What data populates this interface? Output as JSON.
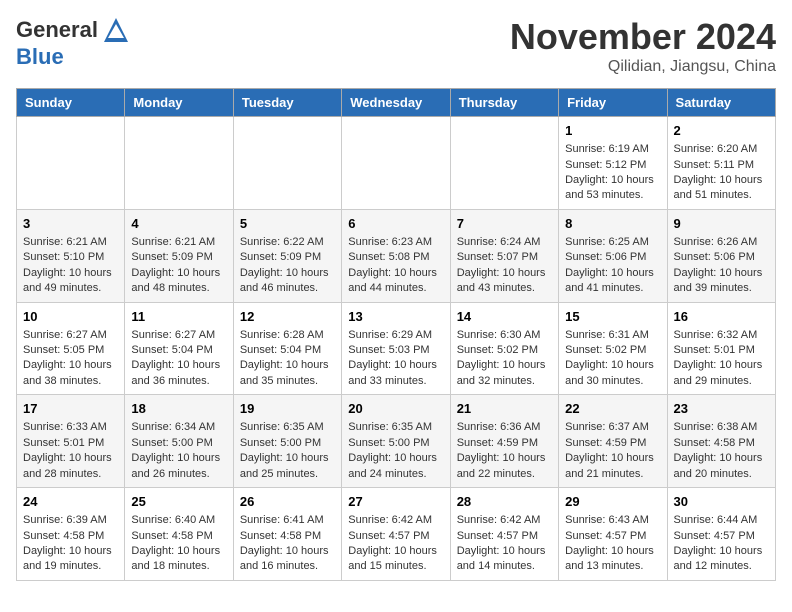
{
  "header": {
    "logo_general": "General",
    "logo_blue": "Blue",
    "month_title": "November 2024",
    "location": "Qilidian, Jiangsu, China"
  },
  "days_of_week": [
    "Sunday",
    "Monday",
    "Tuesday",
    "Wednesday",
    "Thursday",
    "Friday",
    "Saturday"
  ],
  "weeks": [
    [
      {
        "day": "",
        "info": ""
      },
      {
        "day": "",
        "info": ""
      },
      {
        "day": "",
        "info": ""
      },
      {
        "day": "",
        "info": ""
      },
      {
        "day": "",
        "info": ""
      },
      {
        "day": "1",
        "info": "Sunrise: 6:19 AM\nSunset: 5:12 PM\nDaylight: 10 hours\nand 53 minutes."
      },
      {
        "day": "2",
        "info": "Sunrise: 6:20 AM\nSunset: 5:11 PM\nDaylight: 10 hours\nand 51 minutes."
      }
    ],
    [
      {
        "day": "3",
        "info": "Sunrise: 6:21 AM\nSunset: 5:10 PM\nDaylight: 10 hours\nand 49 minutes."
      },
      {
        "day": "4",
        "info": "Sunrise: 6:21 AM\nSunset: 5:09 PM\nDaylight: 10 hours\nand 48 minutes."
      },
      {
        "day": "5",
        "info": "Sunrise: 6:22 AM\nSunset: 5:09 PM\nDaylight: 10 hours\nand 46 minutes."
      },
      {
        "day": "6",
        "info": "Sunrise: 6:23 AM\nSunset: 5:08 PM\nDaylight: 10 hours\nand 44 minutes."
      },
      {
        "day": "7",
        "info": "Sunrise: 6:24 AM\nSunset: 5:07 PM\nDaylight: 10 hours\nand 43 minutes."
      },
      {
        "day": "8",
        "info": "Sunrise: 6:25 AM\nSunset: 5:06 PM\nDaylight: 10 hours\nand 41 minutes."
      },
      {
        "day": "9",
        "info": "Sunrise: 6:26 AM\nSunset: 5:06 PM\nDaylight: 10 hours\nand 39 minutes."
      }
    ],
    [
      {
        "day": "10",
        "info": "Sunrise: 6:27 AM\nSunset: 5:05 PM\nDaylight: 10 hours\nand 38 minutes."
      },
      {
        "day": "11",
        "info": "Sunrise: 6:27 AM\nSunset: 5:04 PM\nDaylight: 10 hours\nand 36 minutes."
      },
      {
        "day": "12",
        "info": "Sunrise: 6:28 AM\nSunset: 5:04 PM\nDaylight: 10 hours\nand 35 minutes."
      },
      {
        "day": "13",
        "info": "Sunrise: 6:29 AM\nSunset: 5:03 PM\nDaylight: 10 hours\nand 33 minutes."
      },
      {
        "day": "14",
        "info": "Sunrise: 6:30 AM\nSunset: 5:02 PM\nDaylight: 10 hours\nand 32 minutes."
      },
      {
        "day": "15",
        "info": "Sunrise: 6:31 AM\nSunset: 5:02 PM\nDaylight: 10 hours\nand 30 minutes."
      },
      {
        "day": "16",
        "info": "Sunrise: 6:32 AM\nSunset: 5:01 PM\nDaylight: 10 hours\nand 29 minutes."
      }
    ],
    [
      {
        "day": "17",
        "info": "Sunrise: 6:33 AM\nSunset: 5:01 PM\nDaylight: 10 hours\nand 28 minutes."
      },
      {
        "day": "18",
        "info": "Sunrise: 6:34 AM\nSunset: 5:00 PM\nDaylight: 10 hours\nand 26 minutes."
      },
      {
        "day": "19",
        "info": "Sunrise: 6:35 AM\nSunset: 5:00 PM\nDaylight: 10 hours\nand 25 minutes."
      },
      {
        "day": "20",
        "info": "Sunrise: 6:35 AM\nSunset: 5:00 PM\nDaylight: 10 hours\nand 24 minutes."
      },
      {
        "day": "21",
        "info": "Sunrise: 6:36 AM\nSunset: 4:59 PM\nDaylight: 10 hours\nand 22 minutes."
      },
      {
        "day": "22",
        "info": "Sunrise: 6:37 AM\nSunset: 4:59 PM\nDaylight: 10 hours\nand 21 minutes."
      },
      {
        "day": "23",
        "info": "Sunrise: 6:38 AM\nSunset: 4:58 PM\nDaylight: 10 hours\nand 20 minutes."
      }
    ],
    [
      {
        "day": "24",
        "info": "Sunrise: 6:39 AM\nSunset: 4:58 PM\nDaylight: 10 hours\nand 19 minutes."
      },
      {
        "day": "25",
        "info": "Sunrise: 6:40 AM\nSunset: 4:58 PM\nDaylight: 10 hours\nand 18 minutes."
      },
      {
        "day": "26",
        "info": "Sunrise: 6:41 AM\nSunset: 4:58 PM\nDaylight: 10 hours\nand 16 minutes."
      },
      {
        "day": "27",
        "info": "Sunrise: 6:42 AM\nSunset: 4:57 PM\nDaylight: 10 hours\nand 15 minutes."
      },
      {
        "day": "28",
        "info": "Sunrise: 6:42 AM\nSunset: 4:57 PM\nDaylight: 10 hours\nand 14 minutes."
      },
      {
        "day": "29",
        "info": "Sunrise: 6:43 AM\nSunset: 4:57 PM\nDaylight: 10 hours\nand 13 minutes."
      },
      {
        "day": "30",
        "info": "Sunrise: 6:44 AM\nSunset: 4:57 PM\nDaylight: 10 hours\nand 12 minutes."
      }
    ]
  ]
}
